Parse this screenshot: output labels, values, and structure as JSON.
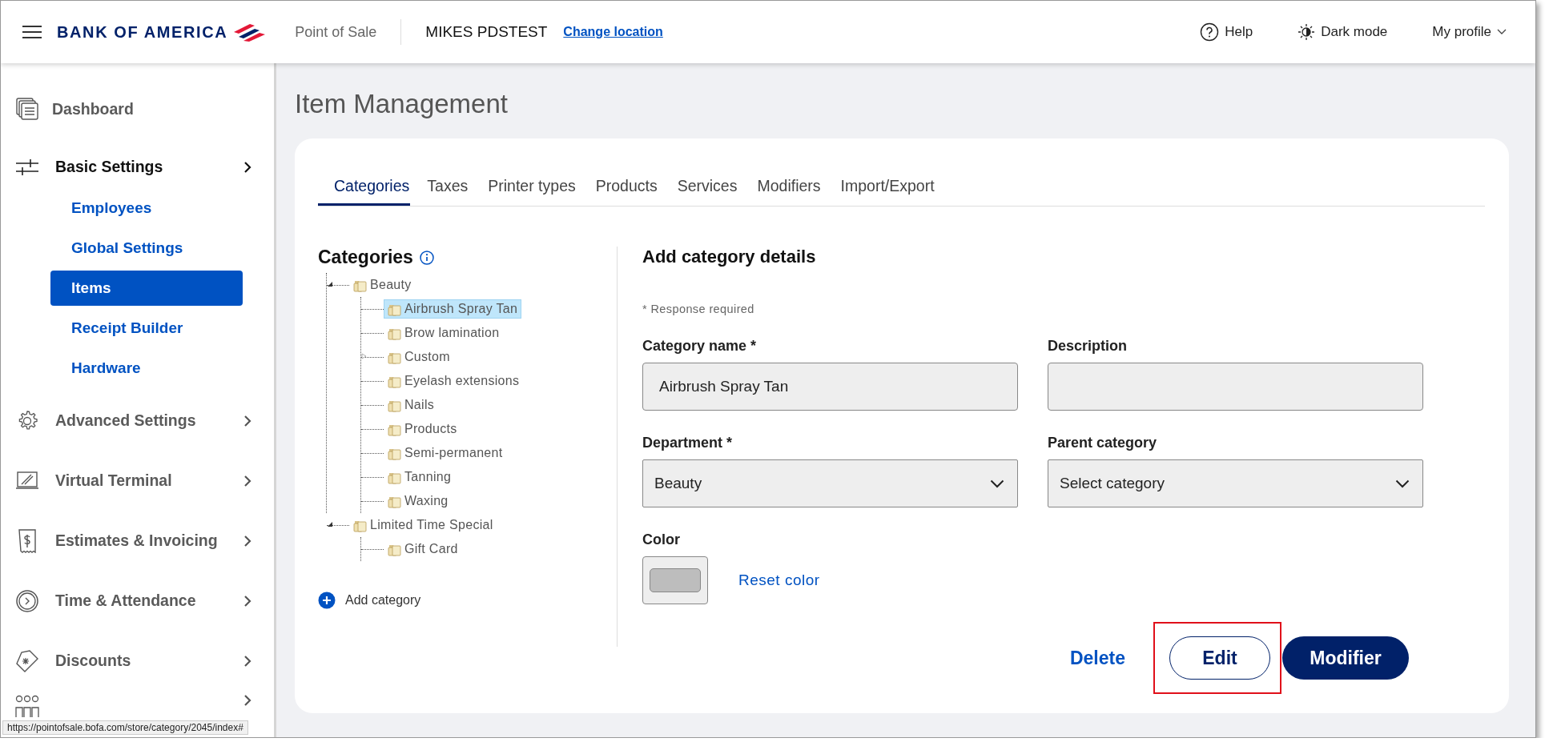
{
  "header": {
    "brand": "BANK OF AMERICA",
    "app_name": "Point of Sale",
    "location": "MIKES PDSTEST",
    "change_location": "Change location",
    "actions": [
      {
        "kind": "help",
        "label": "Help"
      },
      {
        "kind": "theme",
        "label": "Dark mode"
      },
      {
        "kind": "profile",
        "label": "My profile"
      }
    ]
  },
  "sidebar": {
    "items": [
      {
        "label": "Dashboard",
        "kind": "link"
      },
      {
        "label": "Basic Settings",
        "kind": "section",
        "expanded": true,
        "children": [
          {
            "label": "Employees",
            "selected": false
          },
          {
            "label": "Global Settings",
            "selected": false
          },
          {
            "label": "Items",
            "selected": true
          },
          {
            "label": "Receipt Builder",
            "selected": false
          },
          {
            "label": "Hardware",
            "selected": false
          }
        ]
      },
      {
        "label": "Advanced Settings",
        "kind": "section",
        "expanded": false
      },
      {
        "label": "Virtual Terminal",
        "kind": "section",
        "expanded": false
      },
      {
        "label": "Estimates & Invoicing",
        "kind": "section",
        "expanded": false
      },
      {
        "label": "Time & Attendance",
        "kind": "section",
        "expanded": false
      },
      {
        "label": "Discounts",
        "kind": "section",
        "expanded": false
      },
      {
        "kind": "section",
        "expanded": false
      }
    ]
  },
  "page_title": "Item Management",
  "tabs": [
    {
      "label": "Categories",
      "selected": true
    },
    {
      "label": "Taxes",
      "selected": false
    },
    {
      "label": "Printer types",
      "selected": false
    },
    {
      "label": "Products",
      "selected": false
    },
    {
      "label": "Services",
      "selected": false
    },
    {
      "label": "Modifiers",
      "selected": false
    },
    {
      "label": "Import/Export",
      "selected": false
    }
  ],
  "categories": {
    "title": "Categories",
    "tree": [
      {
        "label": "Beauty",
        "selected": false,
        "expanded": true,
        "children": [
          {
            "label": "Airbrush Spray Tan",
            "selected": true
          },
          {
            "label": "Brow lamination",
            "selected": false
          },
          {
            "label": "Custom",
            "selected": false,
            "expanded": false
          },
          {
            "label": "Eyelash extensions",
            "selected": false
          },
          {
            "label": "Nails",
            "selected": false
          },
          {
            "label": "Products",
            "selected": false
          },
          {
            "label": "Semi-permanent",
            "selected": false
          },
          {
            "label": "Tanning",
            "selected": false
          },
          {
            "label": "Waxing",
            "selected": false
          }
        ]
      },
      {
        "label": "Limited Time Special",
        "selected": false,
        "expanded": true,
        "children": [
          {
            "label": "Gift Card",
            "selected": false
          }
        ]
      }
    ],
    "add_label": "Add category"
  },
  "form": {
    "title": "Add category details",
    "note": "* Response required",
    "fields": [
      {
        "label": "Category name *",
        "kind": "text",
        "value": "Airbrush Spray Tan"
      },
      {
        "label": "Description",
        "kind": "text"
      },
      {
        "label": "Department *",
        "kind": "select",
        "value": "Beauty"
      },
      {
        "label": "Parent category",
        "kind": "select",
        "value": "Select category"
      }
    ],
    "color": {
      "label": "Color",
      "color": "#bdbdbd",
      "reset_label": "Reset color"
    },
    "buttons": [
      {
        "label": "Delete",
        "kind": "link"
      },
      {
        "label": "Edit",
        "kind": "outline",
        "highlighted": true
      },
      {
        "label": "Modifier",
        "kind": "primary"
      }
    ]
  },
  "status_url": "https://pointofsale.bofa.com/store/category/2045/index#"
}
